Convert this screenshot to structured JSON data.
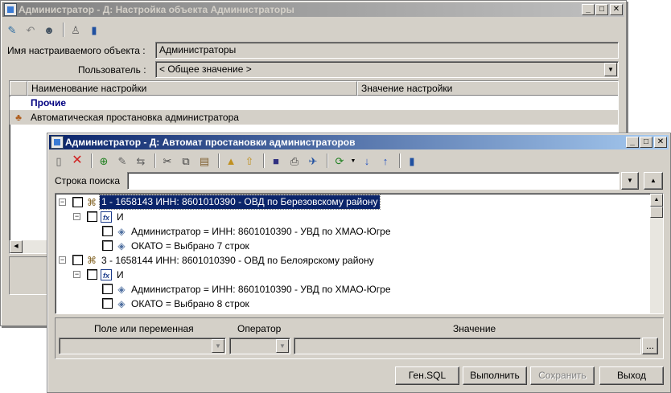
{
  "back_window": {
    "title": "Администратор - Д: Настройка объекта Администраторы",
    "object_label": "Имя настраиваемого объекта :",
    "object_value": "Администраторы",
    "user_label": "Пользователь :",
    "user_value": "< Общее значение >",
    "grid": {
      "columns": [
        "Наименование настройки",
        "Значение настройки"
      ],
      "group": "Прочие",
      "rows": [
        {
          "name": "Автоматическая простановка администратора",
          "value": ""
        }
      ]
    }
  },
  "front_window": {
    "title": "Администратор - Д: Автомат простановки администраторов",
    "search_label": "Строка поиска",
    "search_value": "",
    "tree": [
      {
        "text": "1 - 1658143 ИНН: 8601010390 - ОВД по Березовскому району",
        "selected": true
      },
      {
        "text": "И"
      },
      {
        "text": "Администратор = ИНН: 8601010390 - УВД по ХМАО-Югре"
      },
      {
        "text": "ОКАТО = Выбрано 7 строк"
      },
      {
        "text": "3 - 1658144 ИНН: 8601010390 - ОВД по Белоярскому району"
      },
      {
        "text": "И"
      },
      {
        "text": "Администратор = ИНН: 8601010390 - УВД по ХМАО-Югре"
      },
      {
        "text": "ОКАТО = Выбрано 8 строк"
      }
    ],
    "filter_headers": {
      "field": "Поле или переменная",
      "operator": "Оператор",
      "value": "Значение"
    },
    "buttons": {
      "gen_sql": "Ген.SQL",
      "execute": "Выполнить",
      "save": "Сохранить",
      "exit": "Выход"
    },
    "ellipsis": "..."
  },
  "icons": {
    "group_color": "#000080",
    "selection_bg": "#0a246a"
  }
}
